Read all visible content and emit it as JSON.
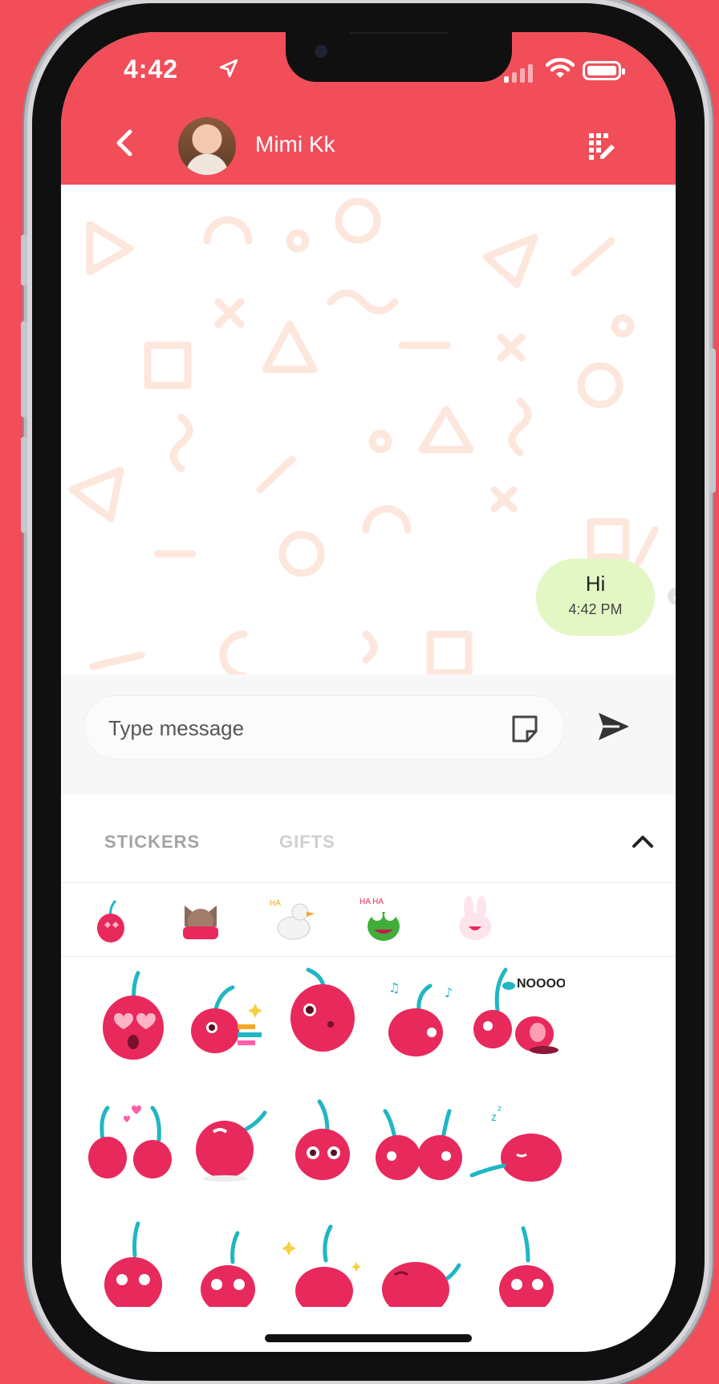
{
  "colors": {
    "accent": "#f14e5a",
    "bubble": "#e3f7c4",
    "sticker_pink": "#e8295b",
    "stem": "#20b6c4"
  },
  "status_bar": {
    "time": "4:42",
    "location_icon": "location-arrow-icon",
    "signal_icon": "signal-icon",
    "wifi_icon": "wifi-icon",
    "battery_icon": "battery-icon"
  },
  "header": {
    "back_icon": "chevron-left-icon",
    "contact_name": "Mimi Kk",
    "menu_icon": "grid-edit-icon"
  },
  "messages": [
    {
      "text": "Hi",
      "time": "4:42 PM",
      "status_icon": "check-circle-icon"
    }
  ],
  "composer": {
    "placeholder": "Type message",
    "sticker_icon": "sticker-icon",
    "send_icon": "send-icon"
  },
  "tabs": [
    {
      "label": "STICKERS",
      "active": true
    },
    {
      "label": "GIFTS",
      "active": false
    }
  ],
  "panel": {
    "collapse_icon": "chevron-up-icon"
  },
  "packs": [
    {
      "name": "cherry-pack"
    },
    {
      "name": "cat-pack"
    },
    {
      "name": "duck-pack"
    },
    {
      "name": "frog-pack"
    },
    {
      "name": "bunny-pack"
    }
  ],
  "stickers": [
    {
      "pose": "heart-eyes"
    },
    {
      "pose": "dash"
    },
    {
      "pose": "kiss"
    },
    {
      "pose": "dance"
    },
    {
      "pose": "noooo",
      "text": "NOOOO"
    },
    {
      "pose": "love-pair"
    },
    {
      "pose": "sleepy-stem"
    },
    {
      "pose": "walk"
    },
    {
      "pose": "hug-pair"
    },
    {
      "pose": "sleeping"
    },
    {
      "pose": "peek"
    },
    {
      "pose": "peek-sweat"
    },
    {
      "pose": "sparkle"
    },
    {
      "pose": "sad"
    },
    {
      "pose": "peek-2"
    }
  ]
}
